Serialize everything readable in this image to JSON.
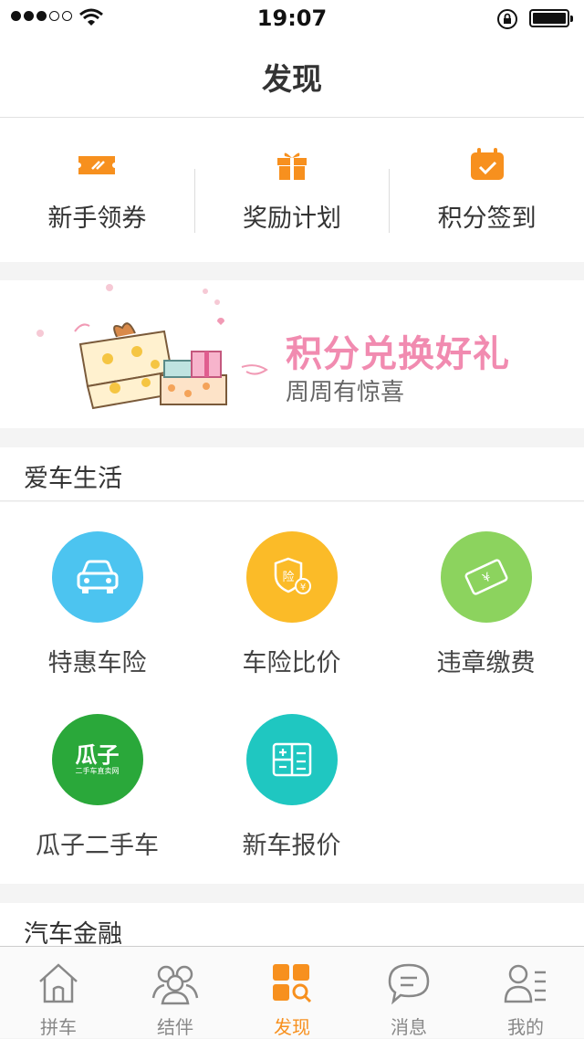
{
  "status_bar": {
    "time": "19:07"
  },
  "navbar": {
    "title": "发现"
  },
  "quick_actions": [
    {
      "label": "新手领券",
      "icon": "ticket-icon"
    },
    {
      "label": "奖励计划",
      "icon": "gift-icon"
    },
    {
      "label": "积分签到",
      "icon": "calendar-check-icon"
    }
  ],
  "banner": {
    "title": "积分兑换好礼",
    "subtitle": "周周有惊喜"
  },
  "section_car_life": {
    "title": "爱车生活"
  },
  "services": [
    {
      "label": "特惠车险",
      "icon": "car-icon",
      "color": "#4cc4f0"
    },
    {
      "label": "车险比价",
      "icon": "insurance-shield-icon",
      "color": "#fbbb28"
    },
    {
      "label": "违章缴费",
      "icon": "ticket-payment-icon",
      "color": "#8cd35e"
    },
    {
      "label": "瓜子二手车",
      "icon": "guazi-logo-icon",
      "color": "#2aa83a",
      "logo_text": "瓜子",
      "logo_sub": "二手车直卖网"
    },
    {
      "label": "新车报价",
      "icon": "calculator-icon",
      "color": "#1fc7c1"
    }
  ],
  "section_finance": {
    "title": "汽车金融"
  },
  "tabs": [
    {
      "label": "拼车",
      "icon": "home-icon",
      "active": false
    },
    {
      "label": "结伴",
      "icon": "group-icon",
      "active": false
    },
    {
      "label": "发现",
      "icon": "discover-icon",
      "active": true
    },
    {
      "label": "消息",
      "icon": "message-icon",
      "active": false
    },
    {
      "label": "我的",
      "icon": "profile-icon",
      "active": false
    }
  ],
  "colors": {
    "accent": "#f7901e",
    "banner_pink": "#f18bb0"
  }
}
